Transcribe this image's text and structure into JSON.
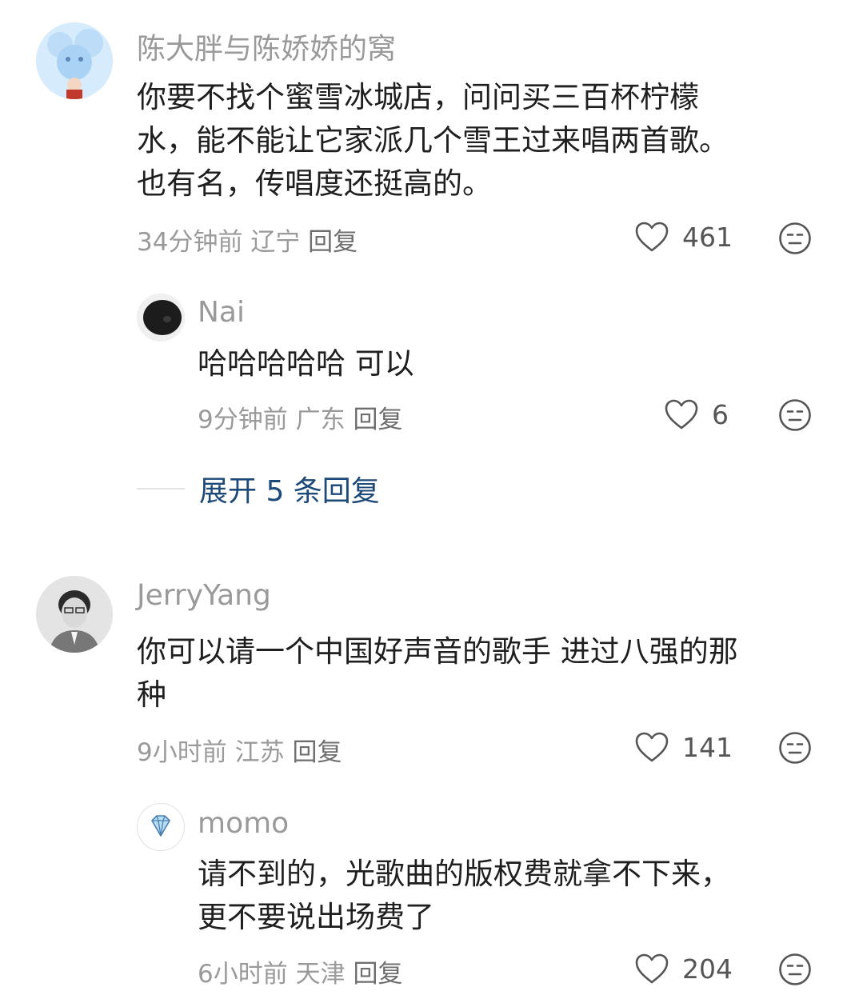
{
  "comments": [
    {
      "user": "陈大胖与陈娇娇的窝",
      "text": "你要不找个蜜雪冰城店，问问买三百杯柠檬\n水，能不能让它家派几个雪王过来唱两首歌。\n也有名，传唱度还挺高的。",
      "time": "34分钟前",
      "location": "辽宁",
      "reply": "回复",
      "likes": "461",
      "replies": [
        {
          "user": "Nai",
          "text": "哈哈哈哈哈 可以",
          "time": "9分钟前",
          "location": "广东",
          "reply": "回复",
          "likes": "6"
        }
      ],
      "expand": "展开 5 条回复"
    },
    {
      "user": "JerryYang",
      "text": "你可以请一个中国好声音的歌手 进过八强的那\n种",
      "time": "9小时前",
      "location": "江苏",
      "reply": "回复",
      "likes": "141",
      "replies": [
        {
          "user": "momo",
          "text": "请不到的，光歌曲的版权费就拿不下来，\n更不要说出场费了",
          "time": "6小时前",
          "location": "天津",
          "reply": "回复",
          "likes": "204"
        }
      ]
    }
  ],
  "icons": {
    "like": "heart-outline-icon",
    "dislike": "neutral-face-icon"
  },
  "colors": {
    "username": "#9a9a9a",
    "expand_link": "#1e4a7a"
  }
}
